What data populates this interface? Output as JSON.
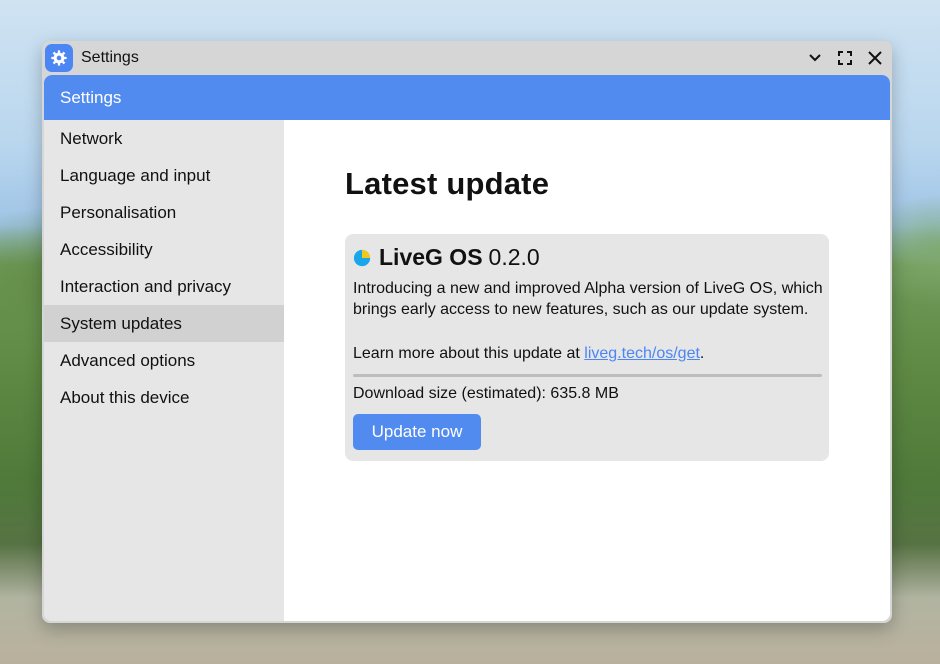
{
  "window": {
    "title": "Settings",
    "controls": [
      "chevron-down-icon",
      "maximize-icon",
      "close-icon"
    ]
  },
  "header": {
    "title": "Settings"
  },
  "sidebar": {
    "items": [
      {
        "label": "Network"
      },
      {
        "label": "Language and input"
      },
      {
        "label": "Personalisation"
      },
      {
        "label": "Accessibility"
      },
      {
        "label": "Interaction and privacy"
      },
      {
        "label": "System updates",
        "active": true
      },
      {
        "label": "Advanced options"
      },
      {
        "label": "About this device"
      }
    ]
  },
  "main": {
    "title": "Latest update",
    "update": {
      "os_name": "LiveG OS",
      "version": "0.2.0",
      "description": "Introducing a new and improved Alpha version of LiveG OS, which brings early access to new features, such as our update system.",
      "learn_more_prefix": "Learn more about this update at",
      "learn_more_link": "liveg.tech/os/get",
      "learn_more_suffix": ".",
      "download_size": "Download size (estimated): 635.8 MB",
      "button_label": "Update now"
    }
  },
  "colors": {
    "accent": "#528bf0",
    "sidebar_bg": "#e6e6e6",
    "sidebar_active": "#d1d1d1",
    "link": "#4b86f4"
  }
}
